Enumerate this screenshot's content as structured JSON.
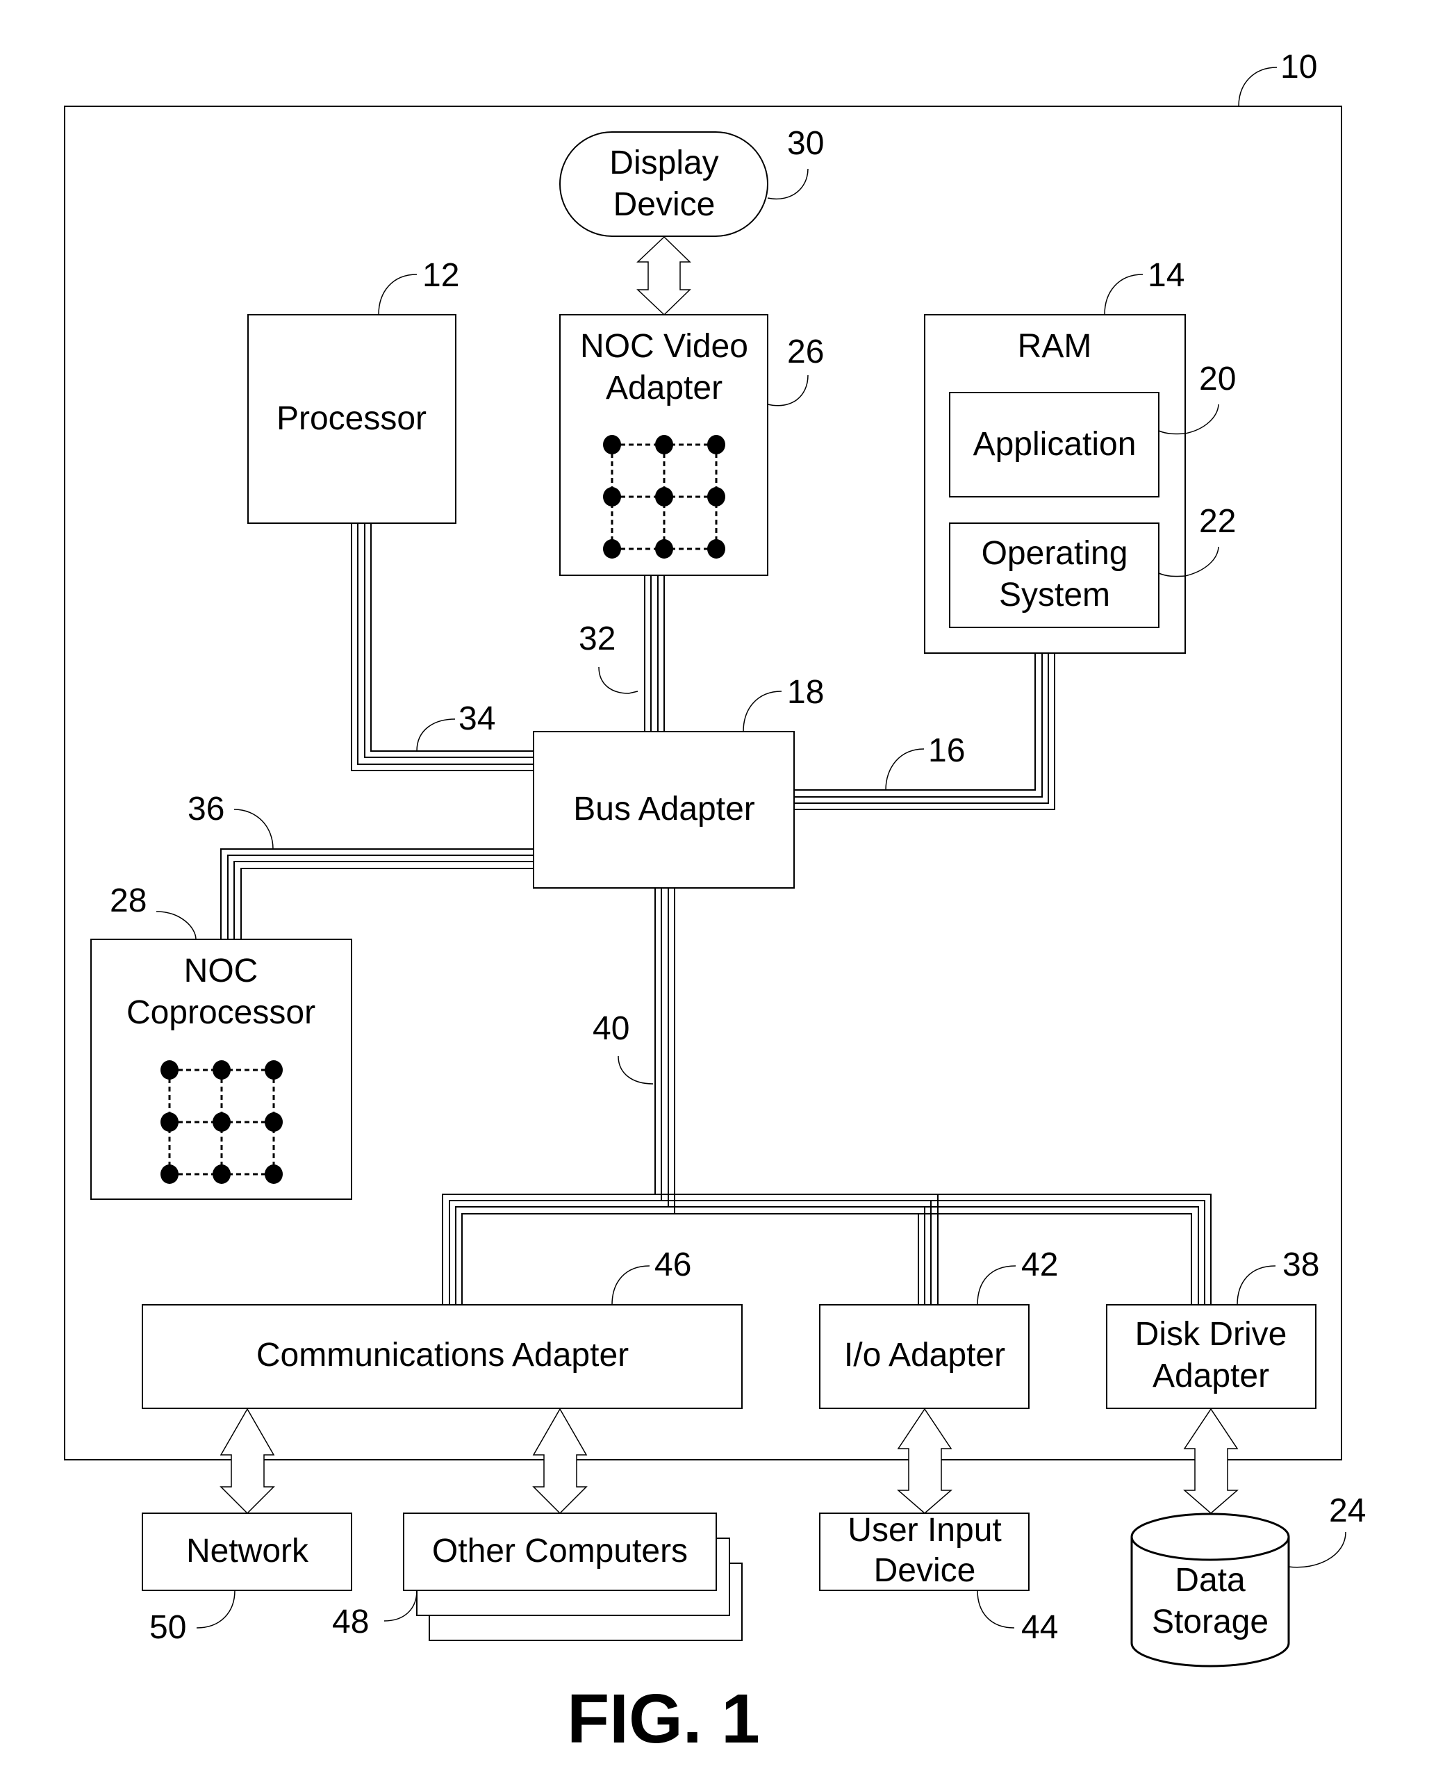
{
  "figure": {
    "caption": "FIG. 1",
    "system_ref": "10"
  },
  "components": {
    "display_device": {
      "lines": [
        "Display",
        "Device"
      ],
      "ref": "30"
    },
    "processor": {
      "lines": [
        "Processor"
      ],
      "ref": "12"
    },
    "noc_video_adapter": {
      "lines": [
        "NOC Video",
        "Adapter"
      ],
      "ref": "26"
    },
    "ram": {
      "lines": [
        "RAM"
      ],
      "ref": "14"
    },
    "application": {
      "lines": [
        "Application"
      ],
      "ref": "20"
    },
    "operating_system": {
      "lines": [
        "Operating",
        "System"
      ],
      "ref": "22"
    },
    "bus_adapter": {
      "lines": [
        "Bus Adapter"
      ],
      "ref": "18"
    },
    "noc_coprocessor": {
      "lines": [
        "NOC",
        "Coprocessor"
      ],
      "ref": "28"
    },
    "communications_adapter": {
      "lines": [
        "Communications Adapter"
      ],
      "ref": "46"
    },
    "io_adapter": {
      "lines": [
        "I/o Adapter"
      ],
      "ref": "42"
    },
    "disk_drive_adapter": {
      "lines": [
        "Disk Drive",
        "Adapter"
      ],
      "ref": "38"
    },
    "network": {
      "lines": [
        "Network"
      ],
      "ref": "50"
    },
    "other_computers": {
      "lines": [
        "Other Computers"
      ],
      "ref": "48"
    },
    "user_input_device": {
      "lines": [
        "User Input",
        "Device"
      ],
      "ref": "44"
    },
    "data_storage": {
      "lines": [
        "Data",
        "Storage"
      ],
      "ref": "24"
    }
  },
  "buses": {
    "front_side_bus": {
      "ref": "34"
    },
    "video_bus": {
      "ref": "32"
    },
    "memory_bus": {
      "ref": "16"
    },
    "coprocessor_bus": {
      "ref": "36"
    },
    "expansion_bus": {
      "ref": "40"
    }
  }
}
